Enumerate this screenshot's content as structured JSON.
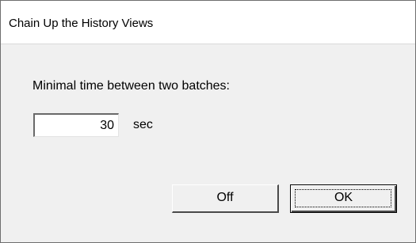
{
  "window": {
    "title": "Chain Up the History Views"
  },
  "form": {
    "label": "Minimal time between two batches:",
    "time_value": "30",
    "unit": "sec"
  },
  "buttons": {
    "off_label": "Off",
    "ok_label": "OK"
  }
}
